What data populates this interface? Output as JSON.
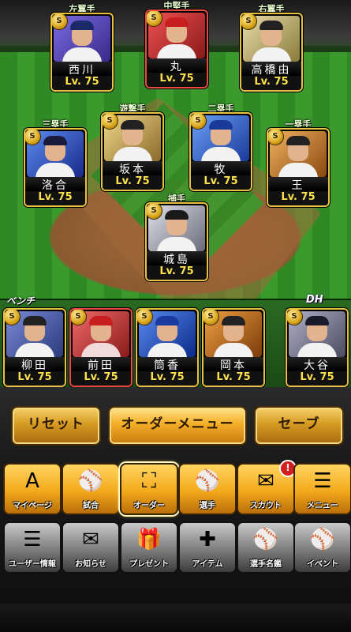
{
  "field": {
    "outfield": [
      {
        "position": "左翼手",
        "name": "西川",
        "level": "Lv. 75",
        "photo": "#5a4cc8",
        "uniform": "#ffffff",
        "border": "gold"
      },
      {
        "position": "中堅手",
        "name": "丸",
        "level": "Lv. 75",
        "photo": "#d23a3a",
        "uniform": "#ffffff",
        "border": "red"
      },
      {
        "position": "右翼手",
        "name": "高橋由",
        "level": "Lv. 75",
        "photo": "#c7b77a",
        "uniform": "#f0f0f0",
        "border": "gold"
      }
    ],
    "infield": [
      {
        "position": "三塁手",
        "name": "洛合",
        "level": "Lv. 75",
        "photo": "#3a6ac8",
        "uniform": "#ffffff",
        "border": "gold"
      },
      {
        "position": "遊撃手",
        "name": "坂本",
        "level": "Lv. 75",
        "photo": "#d0b25c",
        "uniform": "#ffffff",
        "border": "gold"
      },
      {
        "position": "二塁手",
        "name": "牧",
        "level": "Lv. 75",
        "photo": "#3c7ad8",
        "uniform": "#ffffff",
        "border": "gold"
      },
      {
        "position": "一塁手",
        "name": "王",
        "level": "Lv. 75",
        "photo": "#d08a36",
        "uniform": "#f0f0f0",
        "border": "gold"
      }
    ],
    "catcher": {
      "position": "捕手",
      "name": "城島",
      "level": "Lv. 75",
      "photo": "#c8c8d0",
      "uniform": "#ffffff",
      "border": "gold"
    }
  },
  "bench": {
    "label": "ベンチ",
    "dh_label": "DH",
    "players": [
      {
        "name": "柳田",
        "level": "Lv. 75",
        "photo": "#4a5aa8",
        "uniform": "#ffffff"
      },
      {
        "name": "前田",
        "level": "Lv. 75",
        "photo": "#d03a3a",
        "uniform": "#f2dada"
      },
      {
        "name": "筒香",
        "level": "Lv. 75",
        "photo": "#2a5ab8",
        "uniform": "#ffffff"
      },
      {
        "name": "岡本",
        "level": "Lv. 75",
        "photo": "#d08a2a",
        "uniform": "#f0f0f0"
      },
      {
        "name": "大谷",
        "level": "Lv. 75",
        "photo": "#8a8aa0",
        "uniform": "#ffffff"
      }
    ]
  },
  "actions": {
    "reset": "リセット",
    "order_menu": "オーダーメニュー",
    "save": "セーブ"
  },
  "nav_primary": [
    {
      "label": "マイページ",
      "icon": "mypage-icon",
      "glyph": "A",
      "active": false,
      "badge": ""
    },
    {
      "label": "試合",
      "icon": "stadium-icon",
      "glyph": "⚾",
      "active": false,
      "badge": ""
    },
    {
      "label": "オーダー",
      "icon": "order-icon",
      "glyph": "⛶",
      "active": true,
      "badge": ""
    },
    {
      "label": "選手",
      "icon": "player-icon",
      "glyph": "⚾",
      "active": false,
      "badge": ""
    },
    {
      "label": "スカウト",
      "icon": "scout-icon",
      "glyph": "✉",
      "active": false,
      "badge": "!"
    },
    {
      "label": "メニュー",
      "icon": "menu-icon",
      "glyph": "☰",
      "active": false,
      "badge": ""
    }
  ],
  "nav_secondary": [
    {
      "label": "ユーザー情報",
      "icon": "user-info-icon",
      "glyph": "☰"
    },
    {
      "label": "お知らせ",
      "icon": "notice-icon",
      "glyph": "✉"
    },
    {
      "label": "プレゼント",
      "icon": "present-icon",
      "glyph": "🎁"
    },
    {
      "label": "アイテム",
      "icon": "item-icon",
      "glyph": "✚"
    },
    {
      "label": "選手名鑑",
      "icon": "player-book-icon",
      "glyph": "⚾"
    },
    {
      "label": "イベント",
      "icon": "event-icon",
      "glyph": "⚾"
    }
  ]
}
